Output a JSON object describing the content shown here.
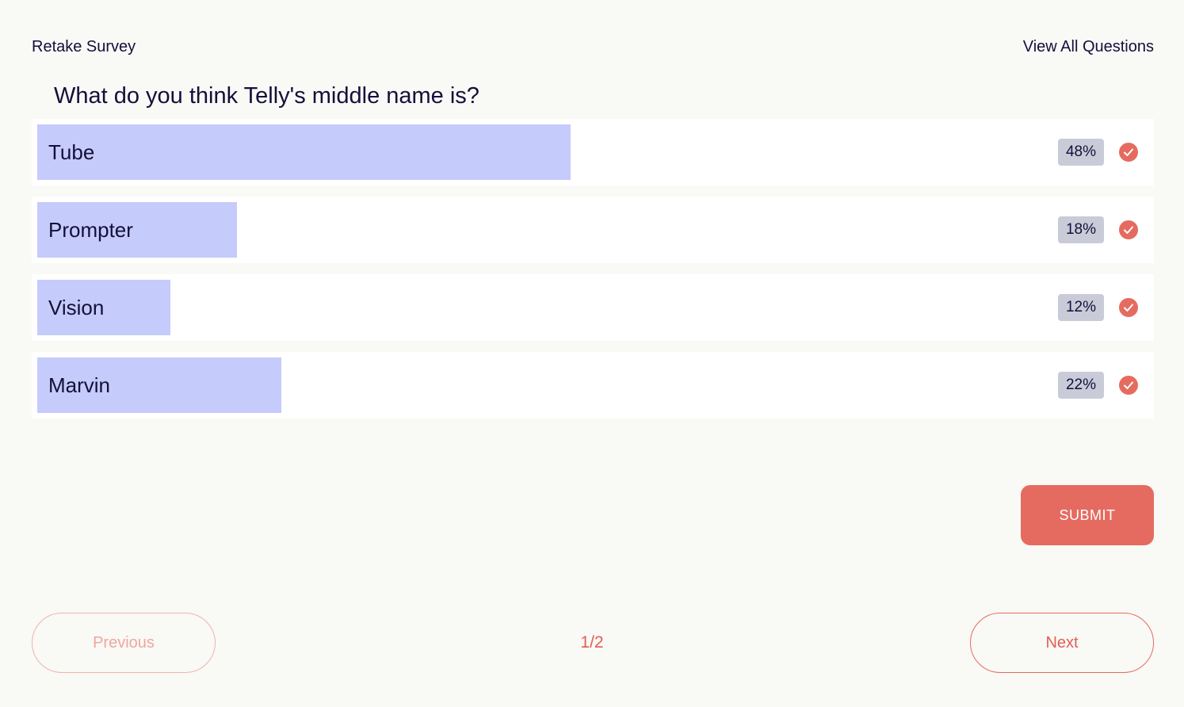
{
  "header": {
    "retake_label": "Retake Survey",
    "view_all_label": "View All Questions"
  },
  "question": {
    "text": "What do you think Telly's middle name is?"
  },
  "options": [
    {
      "label": "Tube",
      "percent_label": "48%",
      "percent": 48,
      "selected": true
    },
    {
      "label": "Prompter",
      "percent_label": "18%",
      "percent": 18,
      "selected": true
    },
    {
      "label": "Vision",
      "percent_label": "12%",
      "percent": 12,
      "selected": true
    },
    {
      "label": "Marvin",
      "percent_label": "22%",
      "percent": 22,
      "selected": true
    }
  ],
  "submit": {
    "label": "SUBMIT"
  },
  "pagination": {
    "previous_label": "Previous",
    "next_label": "Next",
    "indicator": "1/2"
  },
  "colors": {
    "accent": "#e56b60",
    "bar_fill": "#c5cbfa",
    "badge_bg": "#c9cbd8",
    "text": "#13103a",
    "background": "#f9f9f6"
  },
  "icons": {
    "selected_check": "check-circle-icon"
  }
}
